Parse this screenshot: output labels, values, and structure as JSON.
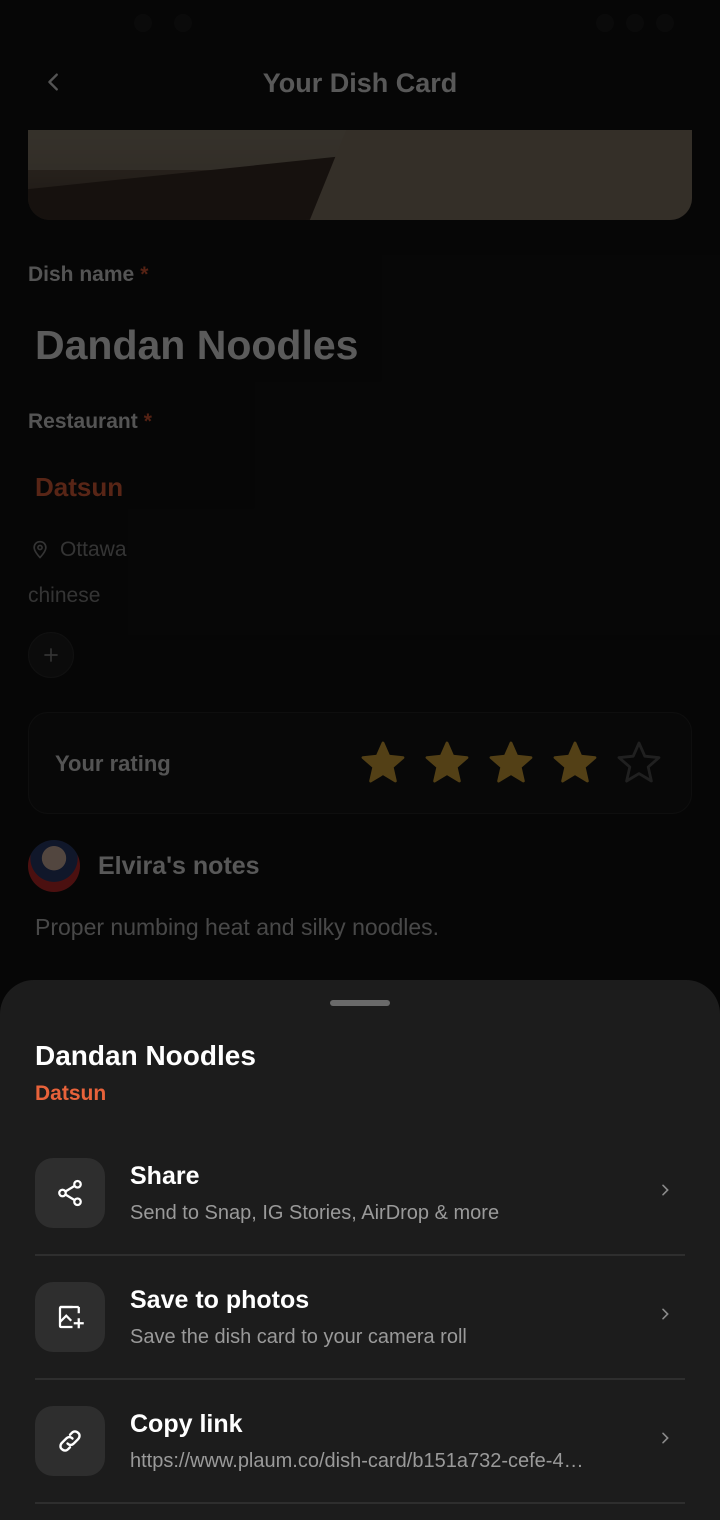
{
  "header": {
    "title": "Your Dish Card"
  },
  "form": {
    "dish_label": "Dish name",
    "dish_value": "Dandan Noodles",
    "restaurant_label": "Restaurant",
    "restaurant_value": "Datsun",
    "location": "Ottawa",
    "cuisine": "chinese",
    "required_mark": "*"
  },
  "rating": {
    "label": "Your rating",
    "value": 4,
    "max": 5,
    "star_color": "#d9a93a"
  },
  "notes": {
    "title": "Elvira's notes",
    "text": "Proper numbing heat and silky noodles."
  },
  "sheet": {
    "title": "Dandan Noodles",
    "subtitle": "Datsun",
    "options": [
      {
        "icon": "share-icon",
        "title": "Share",
        "subtitle": "Send to Snap, IG Stories, AirDrop & more"
      },
      {
        "icon": "save-image-icon",
        "title": "Save to photos",
        "subtitle": "Save the dish card to your camera roll"
      },
      {
        "icon": "link-icon",
        "title": "Copy link",
        "subtitle": "https://www.plaum.co/dish-card/b151a732-cefe-4…"
      }
    ]
  },
  "colors": {
    "accent": "#e8623a",
    "background": "#121212",
    "sheet": "#1c1c1c"
  }
}
